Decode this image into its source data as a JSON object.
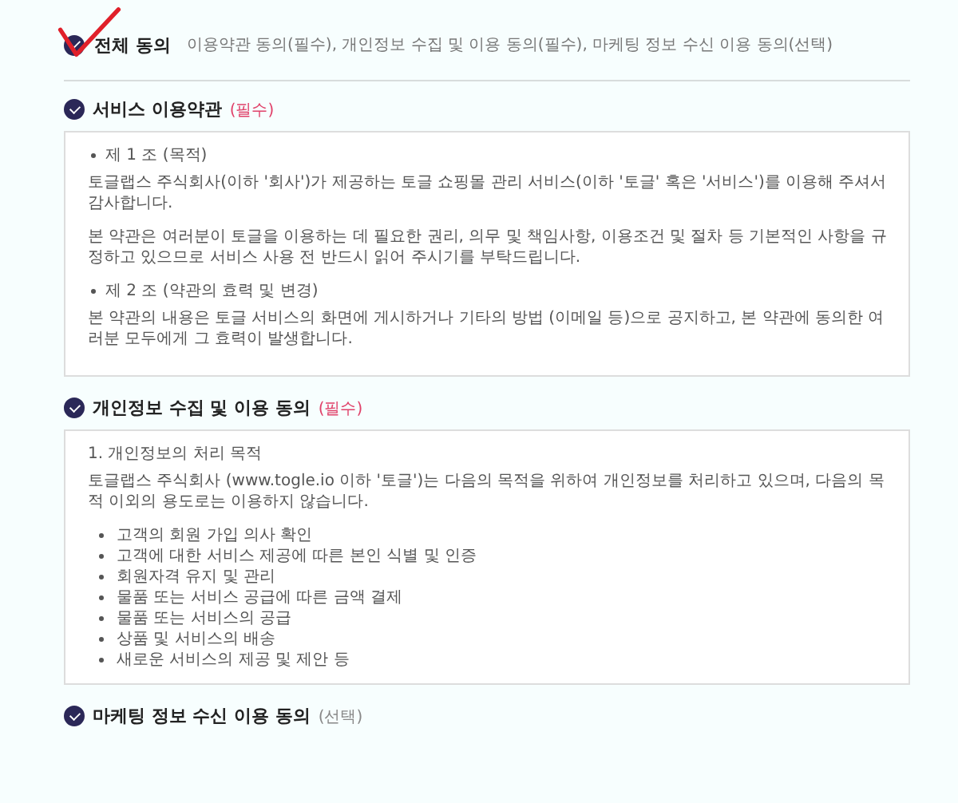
{
  "all_agree": {
    "checked": true,
    "annotated": true,
    "label": "전체 동의",
    "summary": "이용약관 동의(필수), 개인정보 수집 및 이용 동의(필수), 마케팅 정보 수신 이용 동의(선택)"
  },
  "sections": [
    {
      "title": "서비스 이용약관",
      "tag": "(필수)",
      "required": true,
      "checked": true,
      "content": [
        {
          "kind": "article",
          "text": "제 1 조 (목적)"
        },
        {
          "kind": "paragraph",
          "text": "토글랩스 주식회사(이하 '회사')가 제공하는 토글 쇼핑몰 관리 서비스(이하 '토글' 혹은 '서비스')를 이용해 주셔서 감사합니다."
        },
        {
          "kind": "paragraph",
          "text": "본 약관은 여러분이 토글을 이용하는 데 필요한 권리, 의무 및 책임사항, 이용조건 및 절차 등 기본적인 사항을 규정하고 있으므로 서비스 사용 전 반드시 읽어 주시기를 부탁드립니다."
        },
        {
          "kind": "article",
          "text": "제 2 조 (약관의 효력 및 변경)"
        },
        {
          "kind": "paragraph",
          "text": "본 약관의 내용은 토글 서비스의 화면에 게시하거나 기타의 방법 (이메일 등)으로 공지하고, 본 약관에 동의한 여러분 모두에게 그 효력이 발생합니다."
        }
      ]
    },
    {
      "title": "개인정보 수집 및 이용 동의",
      "tag": "(필수)",
      "required": true,
      "checked": true,
      "content": [
        {
          "kind": "heading",
          "text": "1. 개인정보의 처리 목적"
        },
        {
          "kind": "paragraph",
          "text": "토글랩스 주식회사 (www.togle.io 이하 '토글')는 다음의 목적을 위하여 개인정보를 처리하고 있으며, 다음의 목적 이외의 용도로는 이용하지 않습니다."
        },
        {
          "kind": "bullet",
          "text": "고객의 회원 가입 의사 확인"
        },
        {
          "kind": "bullet",
          "text": "고객에 대한 서비스 제공에 따른 본인 식별 및 인증"
        },
        {
          "kind": "bullet",
          "text": "회원자격 유지 및 관리"
        },
        {
          "kind": "bullet",
          "text": "물품 또는 서비스 공급에 따른 금액 결제"
        },
        {
          "kind": "bullet",
          "text": "물품 또는 서비스의 공급"
        },
        {
          "kind": "bullet",
          "text": "상품 및 서비스의 배송"
        },
        {
          "kind": "bullet",
          "text": "새로운 서비스의 제공 및 제안 등"
        }
      ]
    },
    {
      "title": "마케팅 정보 수신 이용 동의",
      "tag": "(선택)",
      "required": false,
      "checked": true
    }
  ]
}
